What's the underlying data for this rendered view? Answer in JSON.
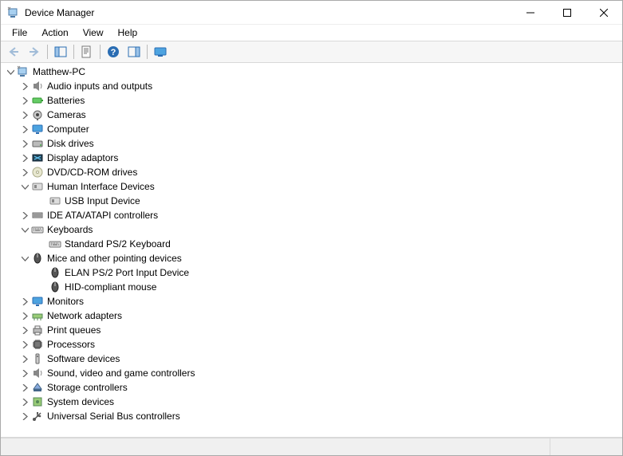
{
  "window": {
    "title": "Device Manager"
  },
  "menu": {
    "file": "File",
    "action": "Action",
    "view": "View",
    "help": "Help"
  },
  "toolbar": {
    "back": "Back",
    "forward": "Forward",
    "show_hide_tree": "Show/Hide Console Tree",
    "properties": "Properties",
    "help": "Help",
    "show_hide_action": "Show/Hide Action Pane",
    "monitor": "Scan for hardware changes"
  },
  "tree": {
    "root": {
      "label": "Matthew-PC",
      "icon": "computer-root",
      "expanded": true
    },
    "items": [
      {
        "label": "Audio inputs and outputs",
        "icon": "audio",
        "expanded": false,
        "children": []
      },
      {
        "label": "Batteries",
        "icon": "battery",
        "expanded": false,
        "children": []
      },
      {
        "label": "Cameras",
        "icon": "camera",
        "expanded": false,
        "children": []
      },
      {
        "label": "Computer",
        "icon": "monitor",
        "expanded": false,
        "children": []
      },
      {
        "label": "Disk drives",
        "icon": "disk",
        "expanded": false,
        "children": []
      },
      {
        "label": "Display adaptors",
        "icon": "display",
        "expanded": false,
        "children": []
      },
      {
        "label": "DVD/CD-ROM drives",
        "icon": "cd",
        "expanded": false,
        "children": []
      },
      {
        "label": "Human Interface Devices",
        "icon": "hid",
        "expanded": true,
        "children": [
          {
            "label": "USB Input Device",
            "icon": "hid"
          }
        ]
      },
      {
        "label": "IDE ATA/ATAPI controllers",
        "icon": "ide",
        "expanded": false,
        "children": []
      },
      {
        "label": "Keyboards",
        "icon": "keyboard",
        "expanded": true,
        "children": [
          {
            "label": "Standard PS/2 Keyboard",
            "icon": "keyboard"
          }
        ]
      },
      {
        "label": "Mice and other pointing devices",
        "icon": "mouse",
        "expanded": true,
        "children": [
          {
            "label": "ELAN PS/2 Port Input Device",
            "icon": "mouse"
          },
          {
            "label": "HID-compliant mouse",
            "icon": "mouse"
          }
        ]
      },
      {
        "label": "Monitors",
        "icon": "monitor",
        "expanded": false,
        "children": []
      },
      {
        "label": "Network adapters",
        "icon": "network",
        "expanded": false,
        "children": []
      },
      {
        "label": "Print queues",
        "icon": "printer",
        "expanded": false,
        "children": []
      },
      {
        "label": "Processors",
        "icon": "cpu",
        "expanded": false,
        "children": []
      },
      {
        "label": "Software devices",
        "icon": "software",
        "expanded": false,
        "children": []
      },
      {
        "label": "Sound, video and game controllers",
        "icon": "audio",
        "expanded": false,
        "children": []
      },
      {
        "label": "Storage controllers",
        "icon": "storage",
        "expanded": false,
        "children": []
      },
      {
        "label": "System devices",
        "icon": "system",
        "expanded": false,
        "children": []
      },
      {
        "label": "Universal Serial Bus controllers",
        "icon": "usb",
        "expanded": false,
        "children": []
      }
    ]
  }
}
